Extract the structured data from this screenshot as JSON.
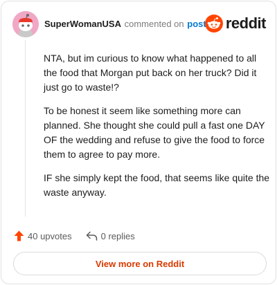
{
  "header": {
    "username": "SuperWomanUSA",
    "commented_text": "commented on",
    "post_link": "post",
    "logo_text": "reddit"
  },
  "comment": {
    "paragraphs": [
      "NTA, but im curious to know what happened to all the food that Morgan put back on her truck? Did it just go to waste!?",
      "To be honest it seem like something more can planned. She thought she could pull a fast one DAY OF the wedding and refuse to give the food to force them to agree to pay more.",
      "IF she simply kept the food, that seems like quite the waste anyway."
    ]
  },
  "actions": {
    "upvotes": "40 upvotes",
    "replies": "0 replies"
  },
  "footer": {
    "view_more": "View more on Reddit"
  },
  "colors": {
    "brand": "#ff4500",
    "link": "#0079d3",
    "cta": "#d93a00",
    "avatar_bg": "#f0a8c6"
  },
  "icons": {
    "avatar": "snoo-avatar-icon",
    "logo": "reddit-logo-icon",
    "upvote": "upvote-arrow-icon",
    "reply": "reply-arrow-icon"
  }
}
